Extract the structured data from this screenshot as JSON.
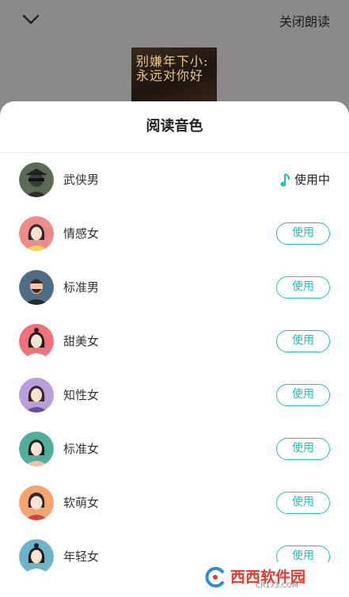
{
  "header": {
    "close_label": "关闭朗读"
  },
  "cover": {
    "line1": "别嫌年下小:",
    "line2": "永远对你好"
  },
  "sheet": {
    "title": "阅读音色"
  },
  "voices": [
    {
      "name": "武侠男",
      "status": "使用中",
      "avatar_color": "#5b6b55"
    },
    {
      "name": "情感女",
      "action": "使用",
      "avatar_color": "#ee8a8a"
    },
    {
      "name": "标准男",
      "action": "使用",
      "avatar_color": "#4f6d85"
    },
    {
      "name": "甜美女",
      "action": "使用",
      "avatar_color": "#f2707a"
    },
    {
      "name": "知性女",
      "action": "使用",
      "avatar_color": "#b9a0dc"
    },
    {
      "name": "标准女",
      "action": "使用",
      "avatar_color": "#4fb09a"
    },
    {
      "name": "软萌女",
      "action": "使用",
      "avatar_color": "#f5a36f"
    },
    {
      "name": "年轻女",
      "action": "使用",
      "avatar_color": "#6ab6c8"
    }
  ],
  "accent": "#2bbfb3",
  "watermark": {
    "brand": "西西软件园",
    "url": "CR173.COM"
  },
  "icons": [
    "chevron-down-icon",
    "music-note-icon"
  ]
}
